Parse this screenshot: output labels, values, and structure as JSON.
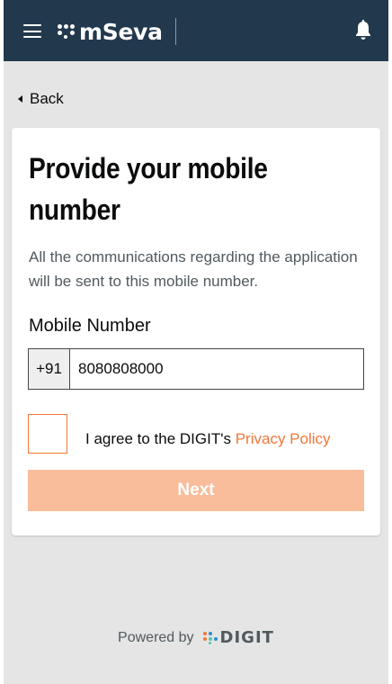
{
  "header": {
    "app_name": "mSeva",
    "menu_icon": "hamburger-menu-icon",
    "notification_icon": "bell-icon",
    "background_color": "#22394d"
  },
  "back": {
    "label": "Back",
    "icon": "caret-left-icon"
  },
  "form": {
    "title": "Provide your mobile number",
    "description": "All the communications regarding the application will be sent to this mobile number.",
    "mobile_label": "Mobile Number",
    "country_code": "+91",
    "mobile_value": "8080808000",
    "agree_text": "I agree to the DIGIT's ",
    "privacy_link": "Privacy Policy",
    "checkbox_checked": false,
    "next_label": "Next"
  },
  "footer": {
    "powered_by": "Powered by",
    "brand": "DIGIT"
  },
  "colors": {
    "accent": "#f47738",
    "button_disabled": "#f9bd9b",
    "page_background": "#e5e5e5",
    "text": "#0b0c0c",
    "secondary_text": "#505a5f"
  }
}
